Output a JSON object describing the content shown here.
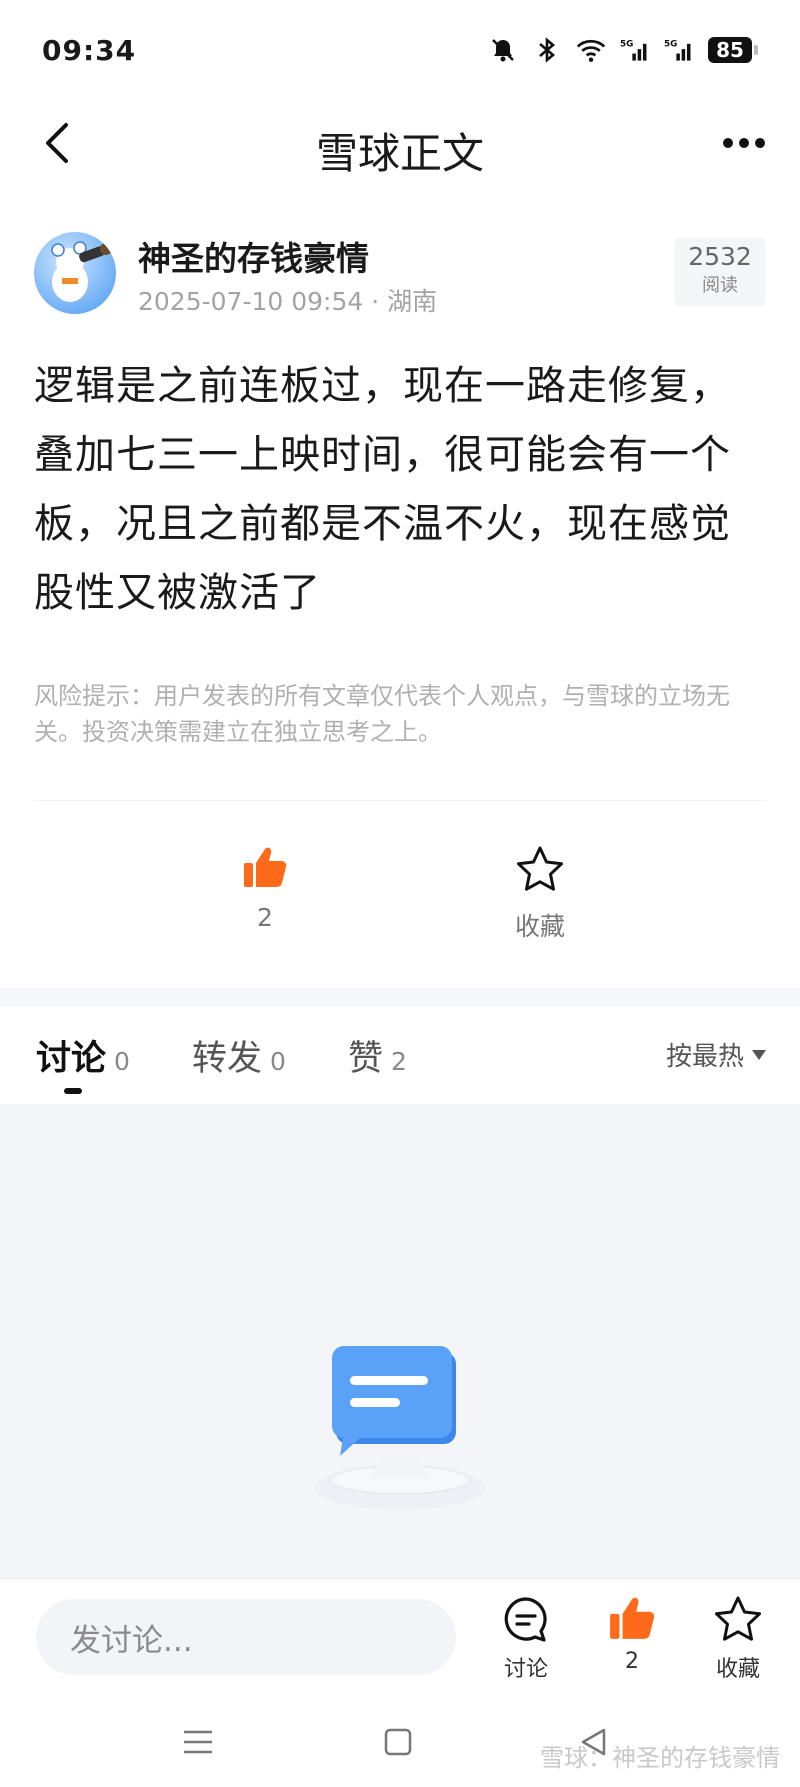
{
  "status_bar": {
    "time": "09:34",
    "battery": "85",
    "icons": [
      "mute-icon",
      "bluetooth-icon",
      "wifi-icon",
      "signal-5g-icon",
      "signal-5g-icon",
      "battery-icon"
    ]
  },
  "nav": {
    "title": "雪球正文"
  },
  "author": {
    "name": "神圣的存钱豪情",
    "meta": "2025-07-10 09:54 · 湖南",
    "read_count": "2532",
    "read_label": "阅读"
  },
  "post": {
    "content": "逻辑是之前连板过，现在一路走修复，叠加七三一上映时间，很可能会有一个板，况且之前都是不温不火，现在感觉股性又被激活了",
    "risk_notice": "风险提示：用户发表的所有文章仅代表个人观点，与雪球的立场无关。投资决策需建立在独立思考之上。"
  },
  "actions": {
    "like_count": "2",
    "fav_label": "收藏"
  },
  "tabs": [
    {
      "label": "讨论",
      "count": "0"
    },
    {
      "label": "转发",
      "count": "0"
    },
    {
      "label": "赞",
      "count": "2"
    }
  ],
  "sort_label": "按最热",
  "bottom_bar": {
    "comment_placeholder": "发讨论...",
    "discuss_label": "讨论",
    "like_count": "2",
    "fav_label": "收藏"
  },
  "watermark": "雪球：神圣的存钱豪情",
  "colors": {
    "accent_orange": "#ff6a1a",
    "empty_bg": "#f4f5f9",
    "chat_blue": "#4f9af5"
  }
}
